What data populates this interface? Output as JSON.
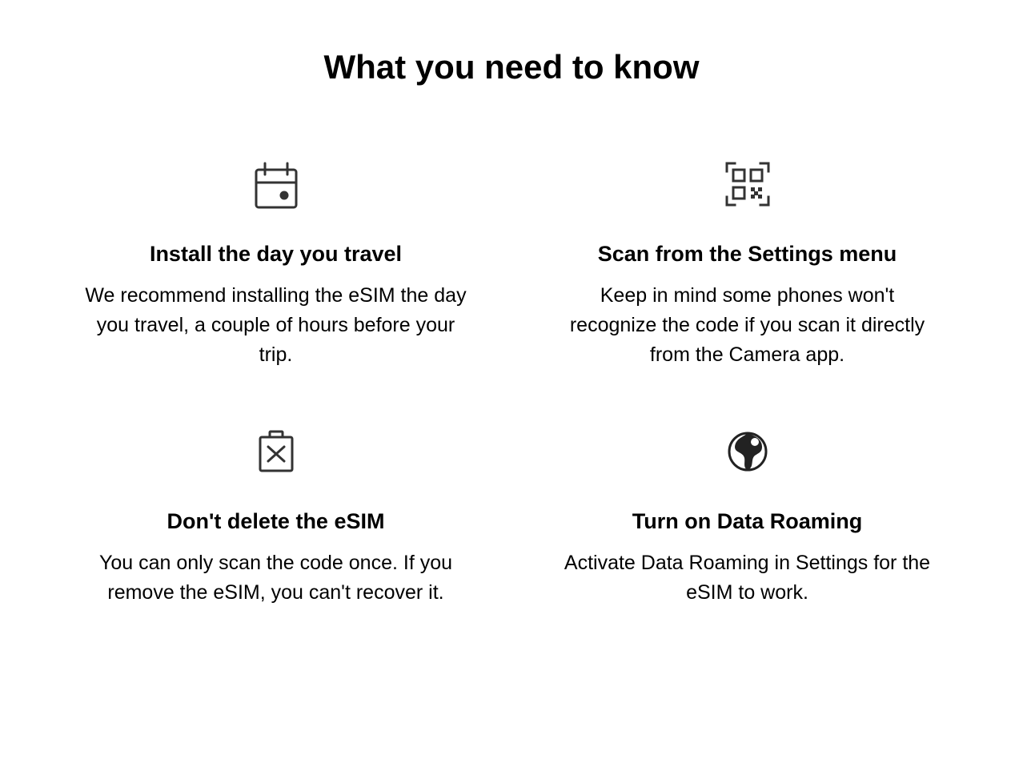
{
  "title": "What you need to know",
  "cards": [
    {
      "icon": "calendar-event-icon",
      "heading": "Install the day you travel",
      "body": "We recommend installing the eSIM the day you travel, a couple of hours before your trip."
    },
    {
      "icon": "qr-scan-icon",
      "heading": "Scan from the Settings menu",
      "body": "Keep in mind some phones won't recognize the code if you scan it directly from the Camera app."
    },
    {
      "icon": "delete-x-icon",
      "heading": "Don't delete the eSIM",
      "body": "You can only scan the code once. If you remove the eSIM, you can't recover it."
    },
    {
      "icon": "globe-icon",
      "heading": "Turn on Data Roaming",
      "body": "Activate Data Roaming in Settings for the eSIM to work."
    }
  ]
}
